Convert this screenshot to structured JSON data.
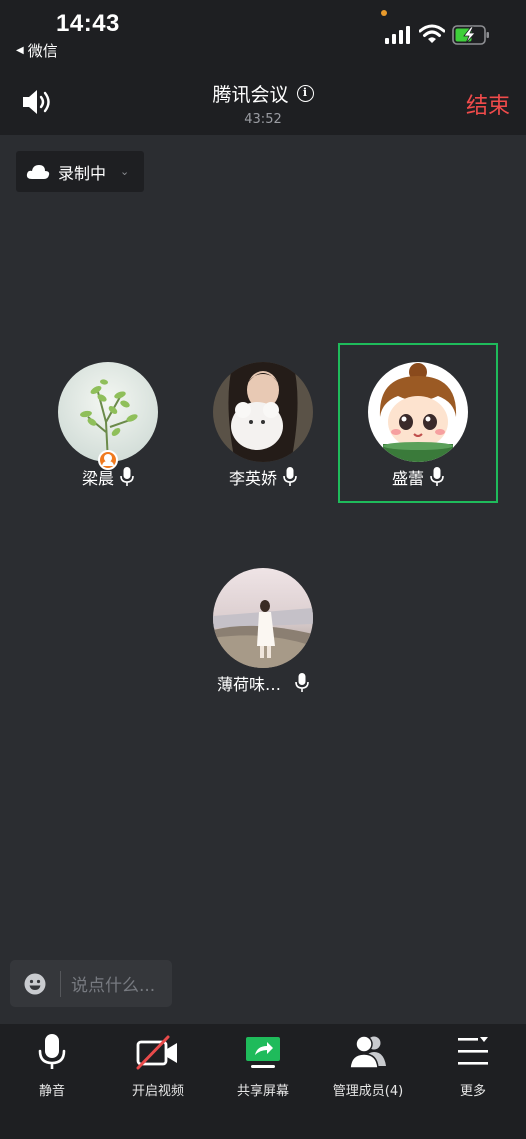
{
  "status_bar": {
    "time": "14:43",
    "back_app": "微信"
  },
  "header": {
    "title": "腾讯会议",
    "duration": "43:52",
    "end_label": "结束"
  },
  "recording": {
    "label": "录制中"
  },
  "participants": [
    {
      "name": "梁晨",
      "host": true,
      "speaking": false
    },
    {
      "name": "李英娇",
      "host": false,
      "speaking": false
    },
    {
      "name": "盛蕾",
      "host": false,
      "speaking": true
    },
    {
      "name": "薄荷味…",
      "host": false,
      "speaking": false
    }
  ],
  "chat": {
    "placeholder": "说点什么..."
  },
  "toolbar": {
    "items": [
      {
        "label": "静音",
        "icon": "mic-icon"
      },
      {
        "label": "开启视频",
        "icon": "video-off-icon"
      },
      {
        "label": "共享屏幕",
        "icon": "share-screen-icon"
      },
      {
        "label": "管理成员(4)",
        "icon": "members-icon"
      },
      {
        "label": "更多",
        "icon": "more-menu-icon"
      }
    ]
  },
  "colors": {
    "background": "#2b2d31",
    "bar": "#1e1f22",
    "end_red": "#f04b4b",
    "speaking_green": "#1fbb5b",
    "share_green": "#1fbb5b",
    "host_orange": "#f07a1f"
  }
}
